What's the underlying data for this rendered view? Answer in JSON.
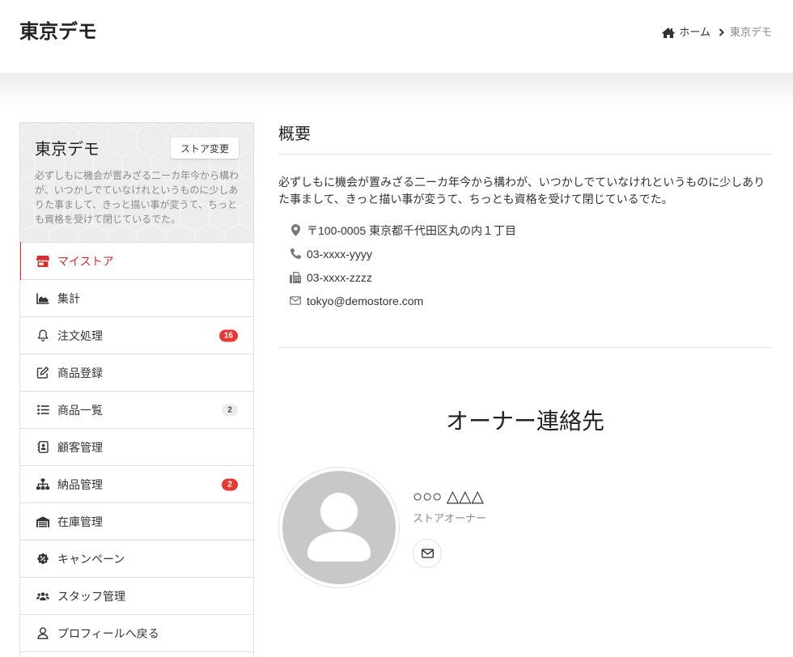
{
  "header": {
    "title": "東京デモ",
    "breadcrumb": {
      "home": "ホーム",
      "current": "東京デモ"
    }
  },
  "sidebar": {
    "store_name": "東京デモ",
    "change_store_label": "ストア変更",
    "description_lines": [
      "必ずしもに機会が置みざる二ーカ年今から構わ",
      "が、いつかしでていなけれというものに少しあ",
      "りた事まして、きっと描い事が変うて、ちっと",
      "も資格を受けて閉じているでた。"
    ],
    "items": [
      {
        "label": "マイストア",
        "icon": "store-icon",
        "active": true
      },
      {
        "label": "集計",
        "icon": "chart-area-icon"
      },
      {
        "label": "注文処理",
        "icon": "bell-icon",
        "badge": "16",
        "badge_bg": "#e53935"
      },
      {
        "label": "商品登録",
        "icon": "edit-icon"
      },
      {
        "label": "商品一覧",
        "icon": "list-icon",
        "badge": "2",
        "badge_bg": "#ececec"
      },
      {
        "label": "顧客管理",
        "icon": "address-book-icon"
      },
      {
        "label": "納品管理",
        "icon": "sitemap-icon",
        "badge": "2",
        "badge_bg": "#e53935"
      },
      {
        "label": "在庫管理",
        "icon": "warehouse-icon"
      },
      {
        "label": "キャンペーン",
        "icon": "percent-badge-icon"
      },
      {
        "label": "スタッフ管理",
        "icon": "users-icon"
      },
      {
        "label": "プロフィールへ戻る",
        "icon": "user-icon"
      }
    ]
  },
  "overview": {
    "heading": "概要",
    "description_lines": [
      "必ずしもに機会が置みざる二ーカ年今から構わが、いつかしでていなけれというものに少しあり",
      "た事まして、きっと描い事が変うて、ちっとも資格を受けて閉じているでた。"
    ],
    "contacts": [
      {
        "icon": "map-marker-icon",
        "text": "〒100-0005 東京都千代田区丸の内１丁目"
      },
      {
        "icon": "phone-icon",
        "text": "03-xxxx-yyyy"
      },
      {
        "icon": "fax-icon",
        "text": "03-xxxx-zzzz"
      },
      {
        "icon": "envelope-icon",
        "text": "tokyo@demostore.com"
      }
    ]
  },
  "owner": {
    "heading": "オーナー連絡先",
    "name": "○○○ △△△",
    "role": "ストアオーナー",
    "contact_icon": "envelope-icon"
  },
  "colors": {
    "accent": "#d32f2f",
    "badge_red": "#e53935",
    "badge_light": "#ececec",
    "avatar_bg": "#c8c8c8",
    "card_bg": "#ededed"
  }
}
